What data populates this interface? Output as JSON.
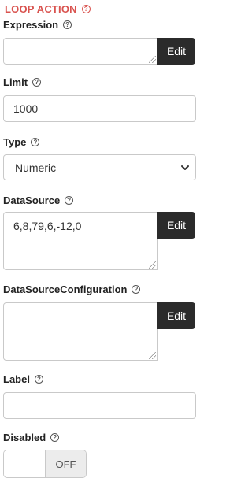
{
  "section": {
    "title": "LOOP ACTION"
  },
  "expression": {
    "label": "Expression",
    "value": "",
    "edit_label": "Edit"
  },
  "limit": {
    "label": "Limit",
    "value": "1000"
  },
  "type": {
    "label": "Type",
    "selected": "Numeric"
  },
  "datasource": {
    "label": "DataSource",
    "value": "6,8,79,6,-12,0",
    "edit_label": "Edit"
  },
  "datasource_configuration": {
    "label": "DataSourceConfiguration",
    "value": "",
    "edit_label": "Edit"
  },
  "label_field": {
    "label": "Label",
    "value": ""
  },
  "disabled": {
    "label": "Disabled",
    "state": "OFF"
  },
  "icons": {
    "help": "help-circle-icon",
    "dropdown": "chevron-down-icon",
    "resize": "resize-grip-icon"
  },
  "colors": {
    "accent": "#d9534f",
    "button_bg": "#2b2b2b",
    "toggle_off_bg": "#ececec"
  }
}
